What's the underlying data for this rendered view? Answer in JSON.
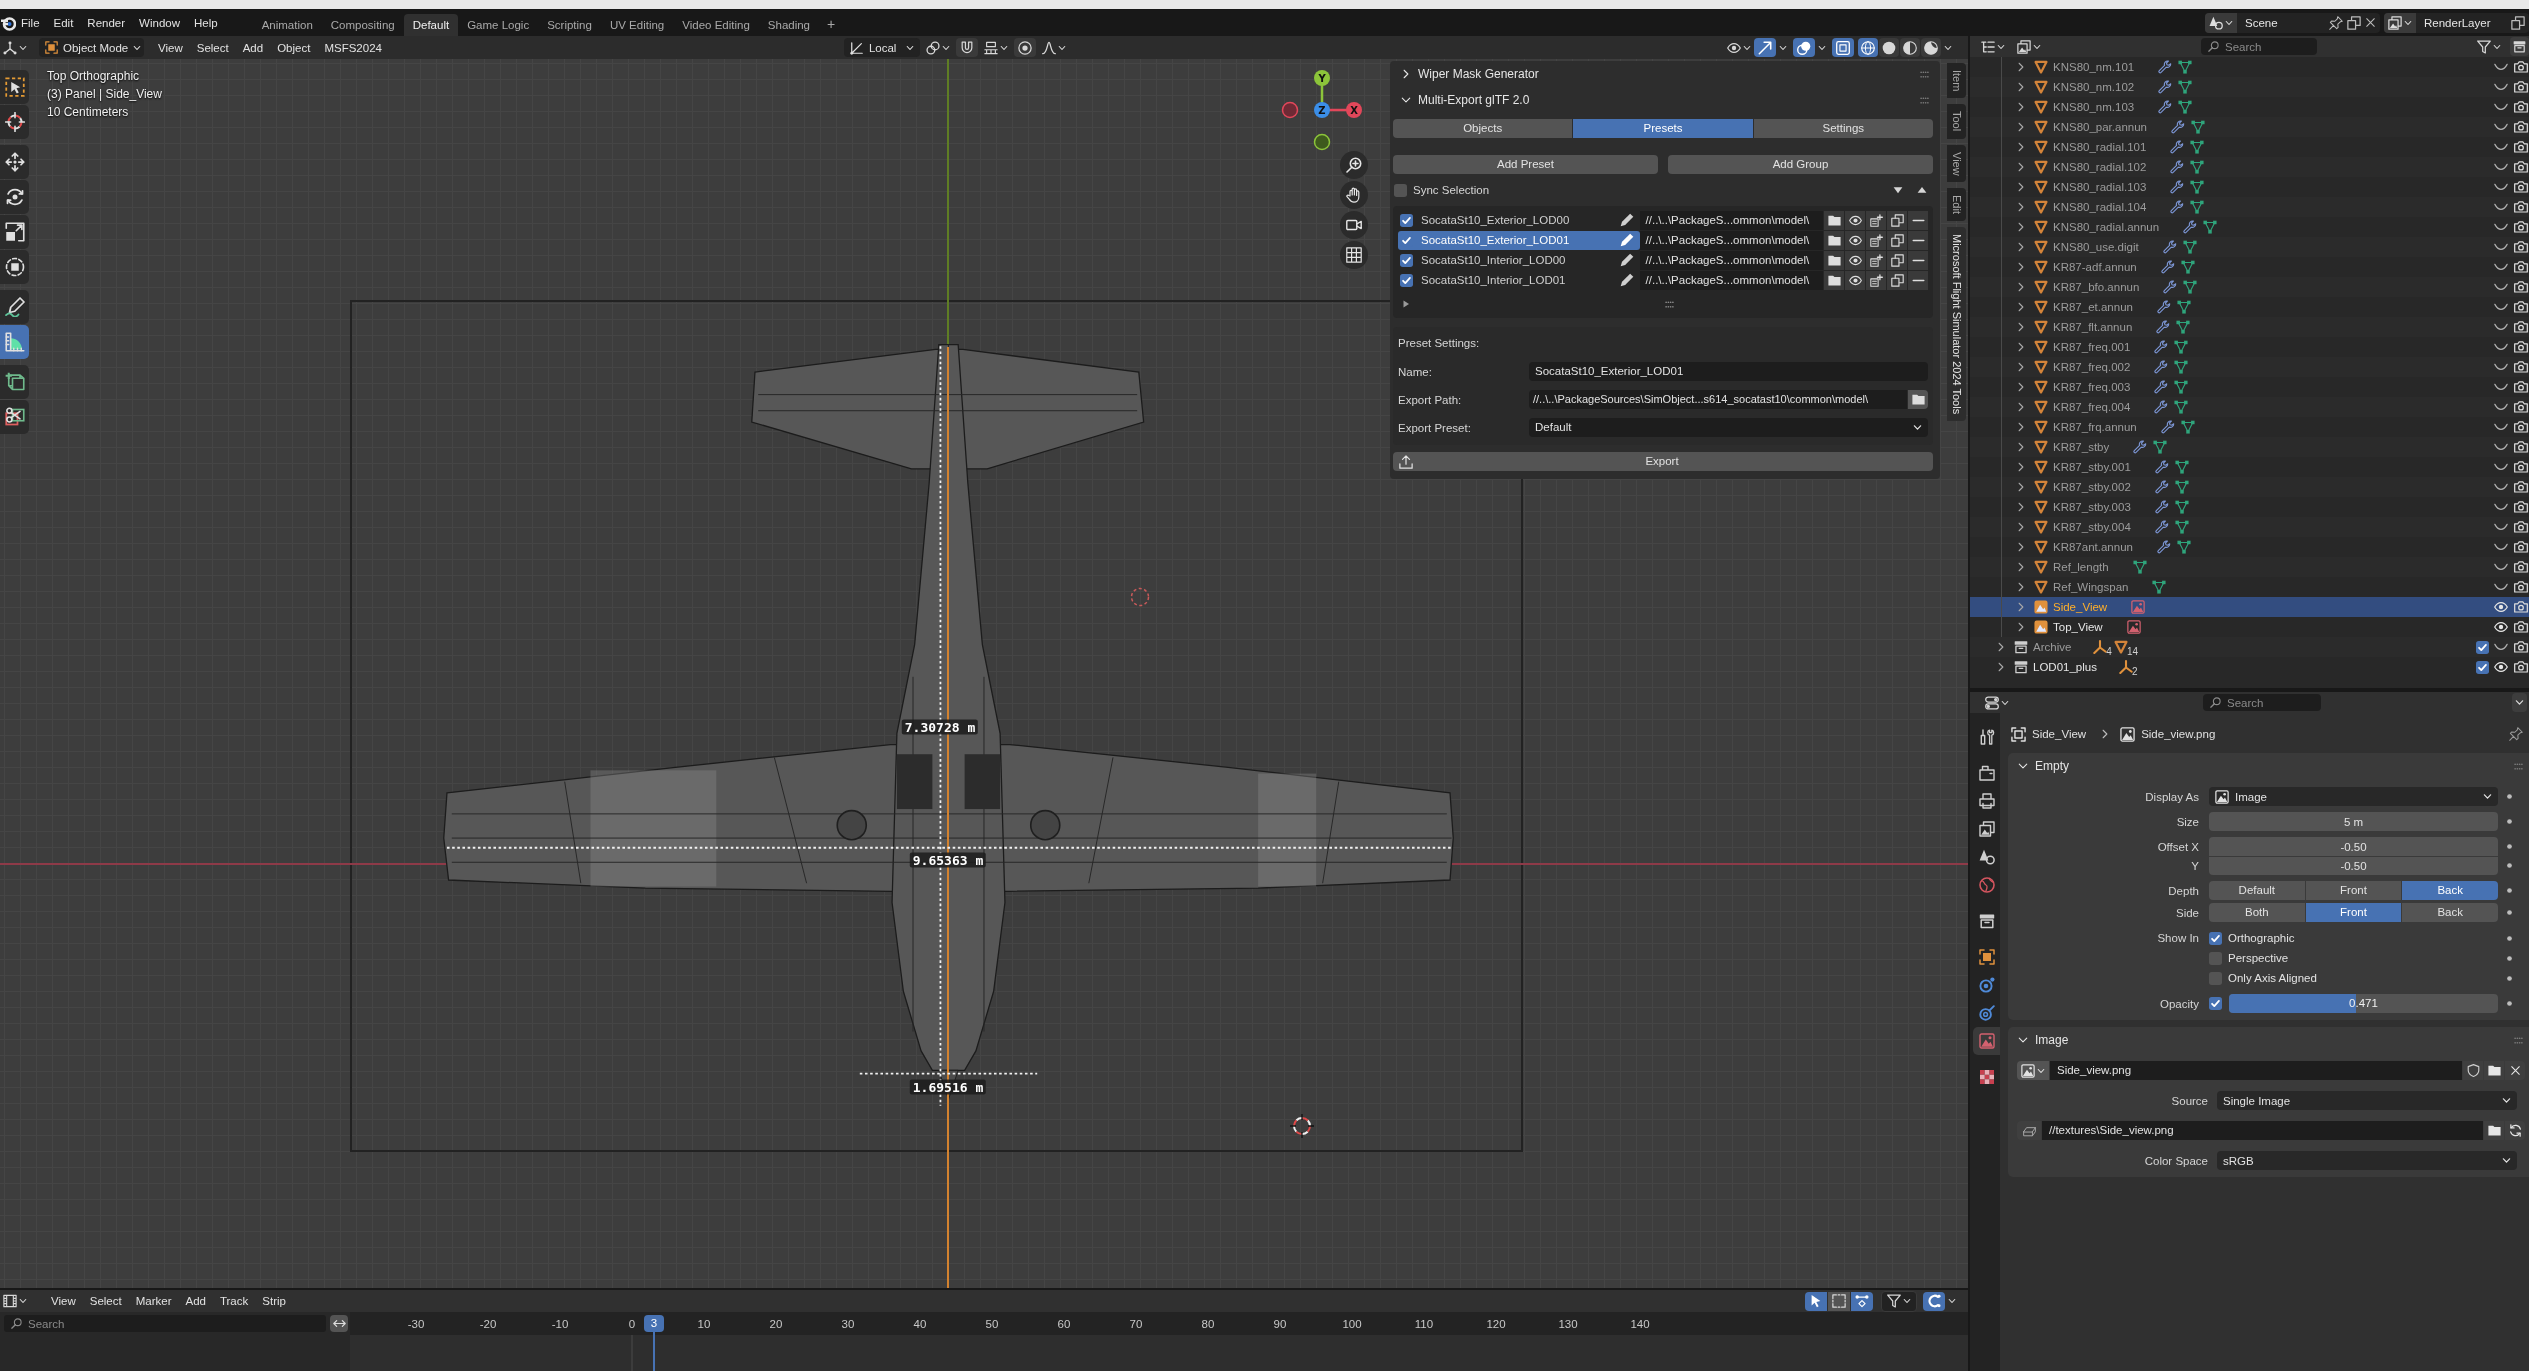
{
  "top_bar": {
    "menus": [
      "File",
      "Edit",
      "Render",
      "Window",
      "Help"
    ],
    "workspaces": [
      {
        "label": "Animation",
        "selected": false
      },
      {
        "label": "Compositing",
        "selected": false
      },
      {
        "label": "Default",
        "selected": true
      },
      {
        "label": "Game Logic",
        "selected": false
      },
      {
        "label": "Scripting",
        "selected": false
      },
      {
        "label": "UV Editing",
        "selected": false
      },
      {
        "label": "Video Editing",
        "selected": false
      },
      {
        "label": "Shading",
        "selected": false
      }
    ],
    "add_workspace": "+",
    "scene": "Scene",
    "view_layer": "RenderLayer"
  },
  "viewport": {
    "header": {
      "mode": "Object Mode",
      "menus": [
        "View",
        "Select",
        "Add",
        "Object",
        "MSFS2024"
      ],
      "orientation": "Local",
      "snapping": [
        {
          "kind": "snap",
          "on": false
        },
        {
          "kind": "proportional",
          "on": false
        }
      ],
      "display_toggles": [
        {
          "kind": "gizmos",
          "on": true
        },
        {
          "kind": "overlays",
          "on": true
        },
        {
          "kind": "xray",
          "on": true
        }
      ],
      "shading": [
        {
          "kind": "wireframe",
          "selected": true
        },
        {
          "kind": "solid",
          "selected": false
        },
        {
          "kind": "material",
          "selected": false
        },
        {
          "kind": "rendered",
          "selected": false
        }
      ]
    },
    "tools": [
      {
        "kind": "select_box",
        "selected": false
      },
      {
        "kind": "cursor",
        "selected": false
      },
      {
        "kind": "move",
        "selected": false
      },
      {
        "kind": "rotate",
        "selected": false
      },
      {
        "kind": "scale",
        "selected": false
      },
      {
        "kind": "transform",
        "selected": false
      },
      {
        "kind": "annotate",
        "selected": false
      },
      {
        "kind": "measure",
        "selected": true
      },
      {
        "kind": "add_cube",
        "selected": false
      },
      {
        "kind": "cut",
        "selected": false
      }
    ],
    "info": [
      "Top Orthographic",
      "(3) Panel | Side_View",
      "10 Centimeters"
    ],
    "gizmo_axes": [
      "Y",
      "X",
      "Z"
    ],
    "measurements": [
      {
        "label": "7.30728 m"
      },
      {
        "label": "9.65363 m"
      },
      {
        "label": "1.69516 m"
      }
    ],
    "sidebar_tabs": [
      {
        "label": "Item",
        "selected": false
      },
      {
        "label": "Tool",
        "selected": false
      },
      {
        "label": "View",
        "selected": false
      },
      {
        "label": "Edit",
        "selected": false
      },
      {
        "label": "Microsoft Flight Simulator 2024 Tools",
        "selected": true
      }
    ],
    "sidebar_panels": [
      {
        "title": "Wiper Mask Generator",
        "expanded": false
      },
      {
        "title": "Multi-Export glTF 2.0",
        "expanded": true,
        "content": {
          "tabs": [
            {
              "label": "Objects",
              "selected": false
            },
            {
              "label": "Presets",
              "selected": true
            },
            {
              "label": "Settings",
              "selected": false
            }
          ],
          "buttons": [
            "Add Preset",
            "Add Group"
          ],
          "sync_selection": {
            "label": "Sync Selection",
            "checked": false
          },
          "presets": [
            {
              "name": "SocataSt10_Exterior_LOD00",
              "enabled": true,
              "selected": false,
              "path": "//..\\..\\PackageS...ommon\\model\\"
            },
            {
              "name": "SocataSt10_Exterior_LOD01",
              "enabled": true,
              "selected": true,
              "path": "//..\\..\\PackageS...ommon\\model\\"
            },
            {
              "name": "SocataSt10_Interior_LOD00",
              "enabled": true,
              "selected": false,
              "path": "//..\\..\\PackageS...ommon\\model\\"
            },
            {
              "name": "SocataSt10_Interior_LOD01",
              "enabled": true,
              "selected": false,
              "path": "//..\\..\\PackageS...ommon\\model\\"
            }
          ],
          "preset_settings": {
            "title": "Preset Settings:",
            "fields": [
              {
                "kind": "text",
                "label": "Name:",
                "value": "SocataSt10_Exterior_LOD01"
              },
              {
                "kind": "path",
                "label": "Export Path:",
                "value": "//..\\..\\PackageSources\\SimObject...s614_socatast10\\common\\model\\"
              },
              {
                "kind": "dropdown",
                "label": "Export Preset:",
                "value": "Default"
              }
            ]
          },
          "export_button": "Export"
        }
      }
    ]
  },
  "outliner": {
    "search_placeholder": "Search",
    "items": [
      {
        "children": [
          {
            "name": "KNS80_nm.101",
            "kind": "mesh",
            "badges": [
              {
                "kind": "modifier"
              },
              {
                "kind": "mesh_data"
              }
            ],
            "visible": false,
            "selected": false,
            "expanded": false
          },
          {
            "name": "KNS80_nm.102",
            "kind": "mesh",
            "badges": [
              {
                "kind": "modifier"
              },
              {
                "kind": "mesh_data"
              }
            ],
            "visible": false,
            "selected": false,
            "expanded": false
          },
          {
            "name": "KNS80_nm.103",
            "kind": "mesh",
            "badges": [
              {
                "kind": "modifier"
              },
              {
                "kind": "mesh_data"
              }
            ],
            "visible": false,
            "selected": false,
            "expanded": false
          },
          {
            "name": "KNS80_par.annun",
            "kind": "mesh",
            "badges": [
              {
                "kind": "modifier"
              },
              {
                "kind": "mesh_data"
              }
            ],
            "visible": false,
            "selected": false,
            "expanded": false
          },
          {
            "name": "KNS80_radial.101",
            "kind": "mesh",
            "badges": [
              {
                "kind": "modifier"
              },
              {
                "kind": "mesh_data"
              }
            ],
            "visible": false,
            "selected": false,
            "expanded": false
          },
          {
            "name": "KNS80_radial.102",
            "kind": "mesh",
            "badges": [
              {
                "kind": "modifier"
              },
              {
                "kind": "mesh_data"
              }
            ],
            "visible": false,
            "selected": false,
            "expanded": false
          },
          {
            "name": "KNS80_radial.103",
            "kind": "mesh",
            "badges": [
              {
                "kind": "modifier"
              },
              {
                "kind": "mesh_data"
              }
            ],
            "visible": false,
            "selected": false,
            "expanded": false
          },
          {
            "name": "KNS80_radial.104",
            "kind": "mesh",
            "badges": [
              {
                "kind": "modifier"
              },
              {
                "kind": "mesh_data"
              }
            ],
            "visible": false,
            "selected": false,
            "expanded": false
          },
          {
            "name": "KNS80_radial.annun",
            "kind": "mesh",
            "badges": [
              {
                "kind": "modifier"
              },
              {
                "kind": "mesh_data"
              }
            ],
            "visible": false,
            "selected": false,
            "expanded": false
          },
          {
            "name": "KNS80_use.digit",
            "kind": "mesh",
            "badges": [
              {
                "kind": "modifier"
              },
              {
                "kind": "mesh_data"
              }
            ],
            "visible": false,
            "selected": false,
            "expanded": false
          },
          {
            "name": "KR87-adf.annun",
            "kind": "mesh",
            "badges": [
              {
                "kind": "modifier"
              },
              {
                "kind": "mesh_data"
              }
            ],
            "visible": false,
            "selected": false,
            "expanded": false
          },
          {
            "name": "KR87_bfo.annun",
            "kind": "mesh",
            "badges": [
              {
                "kind": "modifier"
              },
              {
                "kind": "mesh_data"
              }
            ],
            "visible": false,
            "selected": false,
            "expanded": false
          },
          {
            "name": "KR87_et.annun",
            "kind": "mesh",
            "badges": [
              {
                "kind": "modifier"
              },
              {
                "kind": "mesh_data"
              }
            ],
            "visible": false,
            "selected": false,
            "expanded": false
          },
          {
            "name": "KR87_flt.annun",
            "kind": "mesh",
            "badges": [
              {
                "kind": "modifier"
              },
              {
                "kind": "mesh_data"
              }
            ],
            "visible": false,
            "selected": false,
            "expanded": false
          },
          {
            "name": "KR87_freq.001",
            "kind": "mesh",
            "badges": [
              {
                "kind": "modifier"
              },
              {
                "kind": "mesh_data"
              }
            ],
            "visible": false,
            "selected": false,
            "expanded": false
          },
          {
            "name": "KR87_freq.002",
            "kind": "mesh",
            "badges": [
              {
                "kind": "modifier"
              },
              {
                "kind": "mesh_data"
              }
            ],
            "visible": false,
            "selected": false,
            "expanded": false
          },
          {
            "name": "KR87_freq.003",
            "kind": "mesh",
            "badges": [
              {
                "kind": "modifier"
              },
              {
                "kind": "mesh_data"
              }
            ],
            "visible": false,
            "selected": false,
            "expanded": false
          },
          {
            "name": "KR87_freq.004",
            "kind": "mesh",
            "badges": [
              {
                "kind": "modifier"
              },
              {
                "kind": "mesh_data"
              }
            ],
            "visible": false,
            "selected": false,
            "expanded": false
          },
          {
            "name": "KR87_frq.annun",
            "kind": "mesh",
            "badges": [
              {
                "kind": "modifier"
              },
              {
                "kind": "mesh_data"
              }
            ],
            "visible": false,
            "selected": false,
            "expanded": false
          },
          {
            "name": "KR87_stby",
            "kind": "mesh",
            "badges": [
              {
                "kind": "modifier"
              },
              {
                "kind": "mesh_data"
              }
            ],
            "visible": false,
            "selected": false,
            "expanded": false
          },
          {
            "name": "KR87_stby.001",
            "kind": "mesh",
            "badges": [
              {
                "kind": "modifier"
              },
              {
                "kind": "mesh_data"
              }
            ],
            "visible": false,
            "selected": false,
            "expanded": false
          },
          {
            "name": "KR87_stby.002",
            "kind": "mesh",
            "badges": [
              {
                "kind": "modifier"
              },
              {
                "kind": "mesh_data"
              }
            ],
            "visible": false,
            "selected": false,
            "expanded": false
          },
          {
            "name": "KR87_stby.003",
            "kind": "mesh",
            "badges": [
              {
                "kind": "modifier"
              },
              {
                "kind": "mesh_data"
              }
            ],
            "visible": false,
            "selected": false,
            "expanded": false
          },
          {
            "name": "KR87_stby.004",
            "kind": "mesh",
            "badges": [
              {
                "kind": "modifier"
              },
              {
                "kind": "mesh_data"
              }
            ],
            "visible": false,
            "selected": false,
            "expanded": false
          },
          {
            "name": "KR87ant.annun",
            "kind": "mesh",
            "badges": [
              {
                "kind": "modifier"
              },
              {
                "kind": "mesh_data"
              }
            ],
            "visible": false,
            "selected": false,
            "expanded": false
          },
          {
            "name": "Ref_length",
            "kind": "mesh",
            "badges": [
              {
                "kind": "mesh_data"
              }
            ],
            "visible": false,
            "selected": false,
            "expanded": false
          },
          {
            "name": "Ref_Wingspan",
            "kind": "mesh",
            "badges": [
              {
                "kind": "mesh_data"
              }
            ],
            "visible": false,
            "selected": false,
            "expanded": false
          },
          {
            "name": "Side_View",
            "kind": "image_empty",
            "badges": [
              {
                "kind": "image_data"
              }
            ],
            "visible": true,
            "selected": true,
            "expanded": false
          },
          {
            "name": "Top_View",
            "kind": "image_empty",
            "badges": [
              {
                "kind": "image_data"
              }
            ],
            "visible": true,
            "selected": false,
            "expanded": false
          }
        ]
      },
      {
        "name": "Archive",
        "kind": "collection",
        "counts": [
          {
            "kind": "empty",
            "count": "4"
          },
          {
            "kind": "mesh",
            "count": "14"
          }
        ],
        "included": true,
        "visible": false,
        "selected": false,
        "expanded": false
      },
      {
        "name": "LOD01_plus",
        "kind": "collection",
        "counts": [
          {
            "kind": "empty",
            "count": "2"
          }
        ],
        "included": true,
        "visible": true,
        "selected": false,
        "expanded": false
      }
    ]
  },
  "properties": {
    "search_placeholder": "Search",
    "tabs": [
      {
        "kind": "tool",
        "selected": false
      },
      {
        "kind": "render",
        "selected": false
      },
      {
        "kind": "output",
        "selected": false
      },
      {
        "kind": "view_layer",
        "selected": false
      },
      {
        "kind": "scene",
        "selected": false
      },
      {
        "kind": "world",
        "selected": false
      },
      {
        "kind": "collection",
        "selected": false
      },
      {
        "kind": "object",
        "selected": false
      },
      {
        "kind": "physics",
        "selected": false
      },
      {
        "kind": "constraints",
        "selected": false
      },
      {
        "kind": "data",
        "selected": true
      },
      {
        "kind": "texture",
        "selected": false
      }
    ],
    "breadcrumb": [
      {
        "kind": "object",
        "label": "Side_View"
      },
      {
        "kind": "image",
        "label": "Side_view.png"
      }
    ],
    "panels": [
      {
        "title": "Empty",
        "expanded": true,
        "decorators": true,
        "rows": [
          {
            "kind": "icon_dropdown",
            "label": "Display As",
            "value": "Image"
          },
          {
            "kind": "number",
            "label": "Size",
            "value": "5 m"
          },
          {
            "kind": "vector",
            "labels": [
              "Offset X",
              "Y"
            ],
            "values": [
              "-0.50",
              "-0.50"
            ]
          },
          {
            "kind": "segmented",
            "label": "Depth",
            "options": [
              {
                "label": "Default",
                "selected": false
              },
              {
                "label": "Front",
                "selected": false
              },
              {
                "label": "Back",
                "selected": true
              }
            ]
          },
          {
            "kind": "segmented",
            "label": "Side",
            "options": [
              {
                "label": "Both",
                "selected": false
              },
              {
                "label": "Front",
                "selected": true
              },
              {
                "label": "Back",
                "selected": false
              }
            ]
          },
          {
            "kind": "checkbox_group",
            "label": "Show In",
            "options": [
              {
                "label": "Orthographic",
                "checked": true
              },
              {
                "label": "Perspective",
                "checked": false
              },
              {
                "label": "Only Axis Aligned",
                "checked": false
              }
            ]
          },
          {
            "kind": "slider",
            "label": "Opacity",
            "checked": true,
            "value": "0.471",
            "level": 0.471
          }
        ]
      },
      {
        "title": "Image",
        "expanded": true,
        "decorators": false,
        "rows": [
          {
            "kind": "image_selector",
            "value": "Side_view.png"
          },
          {
            "kind": "dropdown",
            "label": "Source",
            "value": "Single Image"
          },
          {
            "kind": "filepath",
            "value": "//textures\\Side_view.png"
          },
          {
            "kind": "dropdown",
            "label": "Color Space",
            "value": "sRGB"
          }
        ]
      }
    ]
  },
  "timeline": {
    "menus": [
      "View",
      "Select",
      "Marker",
      "Add",
      "Track",
      "Strip"
    ],
    "tools": [
      {
        "kind": "select",
        "selected": true
      },
      {
        "kind": "box_select",
        "selected": false
      },
      {
        "kind": "range",
        "selected": true
      }
    ],
    "display_toggles": [
      {
        "kind": "snapping",
        "on": true
      }
    ],
    "search_placeholder": "Search",
    "ruler": [
      {
        "label": "-30",
        "current": false
      },
      {
        "label": "-20",
        "current": false
      },
      {
        "label": "-10",
        "current": false
      },
      {
        "label": "0",
        "current": false
      },
      {
        "label": "3",
        "current": true
      },
      {
        "label": "10",
        "current": false
      },
      {
        "label": "20",
        "current": false
      },
      {
        "label": "30",
        "current": false
      },
      {
        "label": "40",
        "current": false
      },
      {
        "label": "50",
        "current": false
      },
      {
        "label": "60",
        "current": false
      },
      {
        "label": "70",
        "current": false
      },
      {
        "label": "80",
        "current": false
      },
      {
        "label": "90",
        "current": false
      },
      {
        "label": "100",
        "current": false
      },
      {
        "label": "110",
        "current": false
      },
      {
        "label": "120",
        "current": false
      },
      {
        "label": "130",
        "current": false
      },
      {
        "label": "140",
        "current": false
      }
    ]
  }
}
